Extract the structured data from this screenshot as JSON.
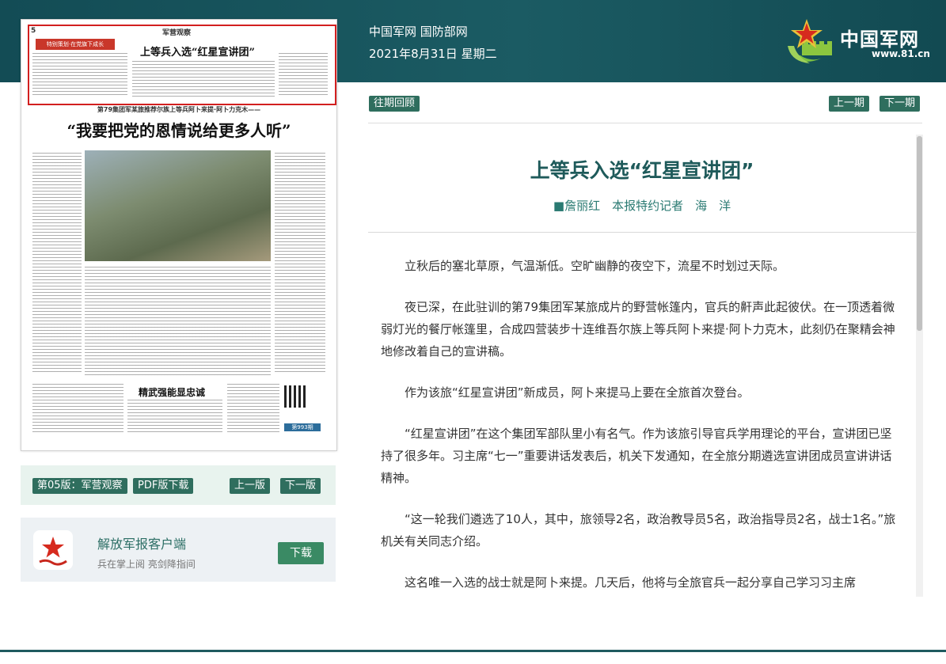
{
  "header": {
    "site_name": "中国军网 国防部网",
    "date": "2021年8月31日 星期二",
    "logo_text": "中国军网",
    "logo_url": "www.81.cn"
  },
  "newspaper": {
    "page_no": "5",
    "section": "军营观察",
    "red_tag": "特别策划·在党旗下成长",
    "headline_top": "上等兵入选“红星宣讲团”",
    "subheadline": "第79集团军某旅推荐尔族上等兵阿卜来提·阿卜力克木——",
    "headline_main": "“我要把党的恩情说给更多人听”",
    "headline_bottom": "精武强能显忠诚",
    "issue_tag": "第993期"
  },
  "edition": {
    "label": "第05版：军营观察",
    "pdf": "PDF版下载",
    "prev": "上一版",
    "next": "下一版"
  },
  "app": {
    "title": "解放军报客户端",
    "desc": "兵在掌上阅 亮剑降指间",
    "download": "下载"
  },
  "nav": {
    "archive": "往期回顾",
    "prev_issue": "上一期",
    "next_issue": "下一期"
  },
  "article": {
    "title": "上等兵入选“红星宣讲团”",
    "author": "■詹丽红　本报特约记者　海　洋",
    "paragraphs": [
      "立秋后的塞北草原，气温渐低。空旷幽静的夜空下，流星不时划过天际。",
      "夜已深，在此驻训的第79集团军某旅成片的野营帐篷内，官兵的鼾声此起彼伏。在一顶透着微弱灯光的餐厅帐篷里，合成四营装步十连维吾尔族上等兵阿卜来提·阿卜力克木，此刻仍在聚精会神地修改着自己的宣讲稿。",
      "作为该旅“红星宣讲团”新成员，阿卜来提马上要在全旅首次登台。",
      "“红星宣讲团”在这个集团军部队里小有名气。作为该旅引导官兵学用理论的平台，宣讲团已坚持了很多年。习主席“七一”重要讲话发表后，机关下发通知，在全旅分期遴选宣讲团成员宣讲讲话精神。",
      "“这一轮我们遴选了10人，其中，旅领导2名，政治教导员5名，政治指导员2名，战士1名。”旅机关有关同志介绍。",
      "这名唯一入选的战士就是阿卜来提。几天后，他将与全旅官兵一起分享自己学习习主席"
    ]
  },
  "colors": {
    "header_bg": "#1b5b63",
    "button_green": "#2f6e5e",
    "title_color": "#1e5a5a",
    "highlight_red": "#d21f1f"
  }
}
